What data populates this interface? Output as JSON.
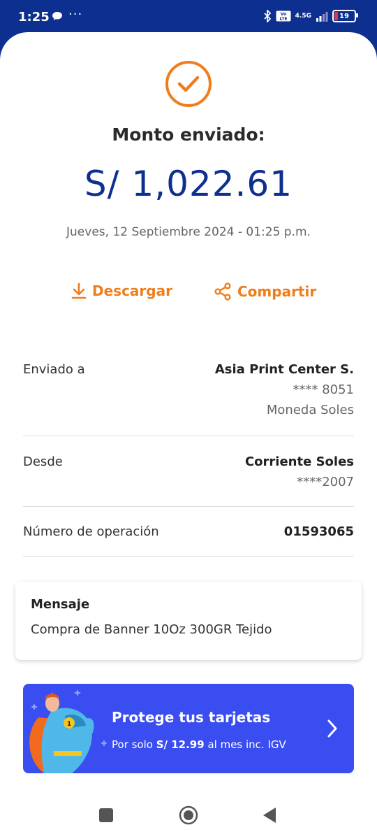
{
  "status": {
    "time": "1:25",
    "dots": "···",
    "network": "4.5G",
    "battery": "19"
  },
  "result": {
    "title": "Monto enviado:",
    "amount": "S/ 1,022.61",
    "date": "Jueves, 12 Septiembre 2024 - 01:25 p.m."
  },
  "actions": {
    "download": "Descargar",
    "share": "Compartir"
  },
  "details": {
    "sent_to": {
      "label": "Enviado a",
      "name": "Asia Print Center S.",
      "account": "**** 8051",
      "currency": "Moneda Soles"
    },
    "from": {
      "label": "Desde",
      "name": "Corriente Soles",
      "account": "****2007"
    },
    "operation": {
      "label": "Número de operación",
      "value": "01593065"
    }
  },
  "message": {
    "title": "Mensaje",
    "text": "Compra de Banner 10Oz 300GR Tejido"
  },
  "promo": {
    "title": "Protege tus tarjetas",
    "sub_prefix": "Por solo ",
    "price": "S/ 12.99",
    "sub_suffix": " al mes inc. IGV"
  },
  "colors": {
    "brand": "#0d2f8f",
    "accent": "#f07d1b",
    "promo": "#3a4df0"
  },
  "icons": [
    "check-circle-icon",
    "download-icon",
    "share-icon",
    "chevron-right-icon",
    "stop-icon",
    "home-icon",
    "back-icon"
  ]
}
